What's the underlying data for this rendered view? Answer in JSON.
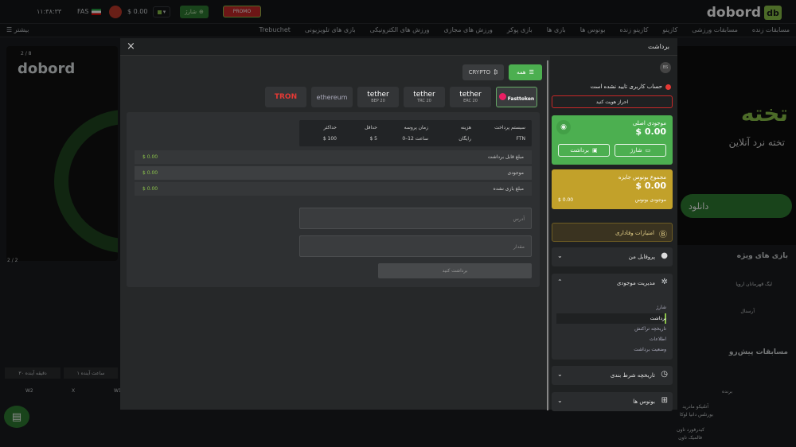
{
  "topbar": {
    "logo": "dobord",
    "logo_mark": "db",
    "clock": "۱۱:۳۸:۳۳",
    "lang": "FAS",
    "balance": "$ 0.00",
    "shaz_label": "شارژ",
    "promo_label": "PROMO"
  },
  "nav": {
    "items": [
      "مسابقات زنده",
      "مسابقات ورزشی",
      "کازینو",
      "کازینو زنده",
      "بونوس ها",
      "بازی ها",
      "بازی پوکر",
      "ورزش های مجازی",
      "ورزش های الکترونیکی",
      "بازی های تلویزیونی",
      "Trebuchet"
    ],
    "more": "بیشتر"
  },
  "background": {
    "banner_logo": "dobord",
    "banner_pager": "2 / 8",
    "banner_counter": "2 / 2",
    "banner_right_big": "تخته",
    "banner_right_sub": "تخته نرد آنلاین",
    "banner_right_btn": "دانلود",
    "special_games": "بازی های ویژه",
    "pre_matches": "مسابقات پیش‌رو",
    "league": "لیگ قهرمانان اروپا",
    "team": "آرسنال",
    "col_winner": "برنده",
    "team_a": "آتلتیکو مادرید",
    "team_b": "بورتلس دانیا لوکا",
    "team_c": "کیدرفورد تاون",
    "team_d": "فالمیک تاون",
    "tab_a": "۳۰ دقیقه آینده",
    "tab_b": "۱ ساعت آینده",
    "w1": "W1",
    "x": "X",
    "w2": "W2"
  },
  "modal": {
    "title": "برداشت",
    "close": "×",
    "filters": {
      "all": "همه",
      "crypto": "CRYPTO"
    },
    "methods": [
      {
        "name": "Fasttoken",
        "sub": "",
        "selected": true
      },
      {
        "name": "tether",
        "sub": "ERC 20"
      },
      {
        "name": "tether",
        "sub": "TRC 20"
      },
      {
        "name": "tether",
        "sub": "BEP 20"
      },
      {
        "name": "ethereum",
        "sub": ""
      },
      {
        "name": "TRON",
        "sub": ""
      }
    ],
    "info": {
      "headers": [
        "سیستم پرداخت",
        "هزینه",
        "زمان پروسه",
        "حداقل",
        "حداکثر"
      ],
      "values": [
        "FTN",
        "رایگان",
        "0–12 ساعت",
        "$ 5",
        "$ 100"
      ]
    },
    "rows": [
      {
        "label": "مبلغ قابل برداشت",
        "value": "$ 0.00"
      },
      {
        "label": "موجودی",
        "value": "$ 0.00"
      },
      {
        "label": "مبلغ بازی نشده",
        "value": "$ 0.00"
      }
    ],
    "address_placeholder": "آدرس",
    "amount_placeholder": "مقدار",
    "submit": "برداشت کنید"
  },
  "panel": {
    "avatar_text": "BS",
    "warning": "حساب کاربری تایید نشده است",
    "kyc": "احراز هویت کنید",
    "main_balance_label": "موجودی اصلی",
    "main_balance": "$ 0.00",
    "deposit_btn": "شارژ",
    "withdraw_btn": "برداشت",
    "bonus_label": "مجموع بونوس جایزه",
    "bonus_amount": "$ 0.00",
    "bonus_sub_label": "موجودی بونوس",
    "bonus_sub_value": "$ 0.00",
    "loyalty": "امتیازات وفاداری",
    "profile": "پروفایل من",
    "wallet": "مدیریت موجودی",
    "wallet_items": [
      "شارژ",
      "برداشت",
      "تاریخچه تراکنش",
      "اطلاعات",
      "وضعیت برداشت"
    ],
    "bet_history": "تاریخچه شرط بندی",
    "bonuses": "بونوس ها"
  }
}
